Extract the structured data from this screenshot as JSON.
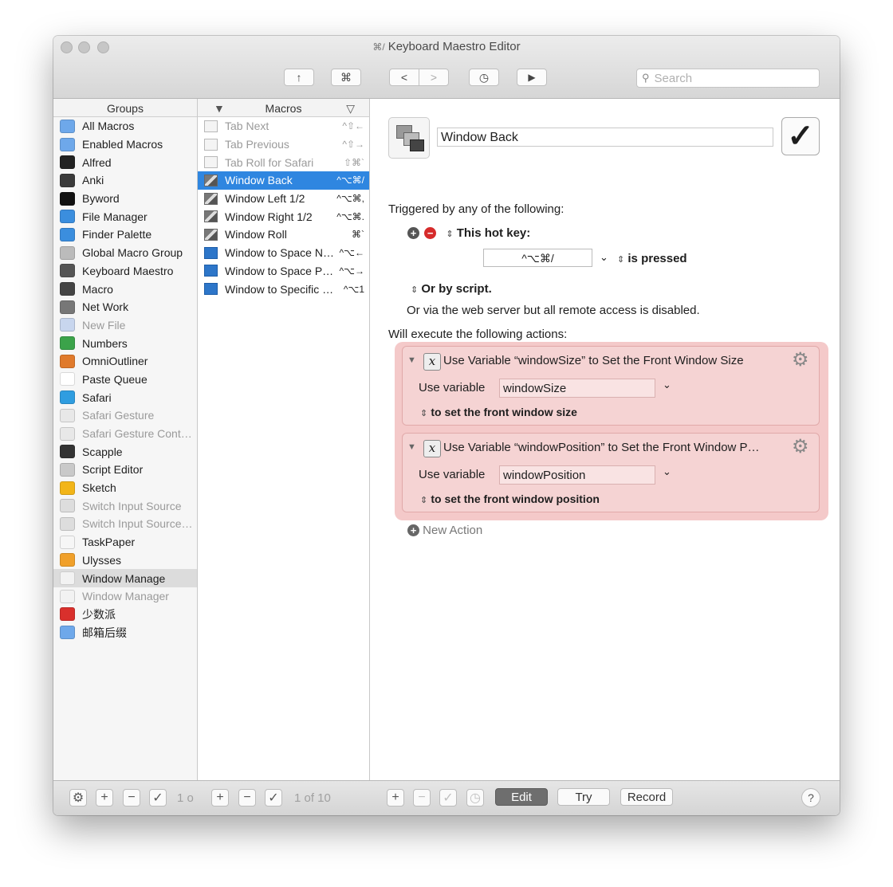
{
  "window": {
    "title": "Keyboard Maestro Editor",
    "title_glyph": "⌘/"
  },
  "toolbar": {
    "share_icon": "↑",
    "cmd_icon": "⌘",
    "back_icon": "<",
    "forward_icon": ">",
    "clock_icon": "◷",
    "run_icon": "▶",
    "search_placeholder": "Search",
    "search_glyph": "⚲"
  },
  "groups": {
    "header": "Groups",
    "items": [
      {
        "label": "All Macros",
        "color": "#6ea8ea",
        "dim": false
      },
      {
        "label": "Enabled Macros",
        "color": "#6ea8ea",
        "dim": false
      },
      {
        "label": "Alfred",
        "color": "#222222",
        "dim": false
      },
      {
        "label": "Anki",
        "color": "#3a3a3a",
        "dim": false
      },
      {
        "label": "Byword",
        "color": "#111111",
        "dim": false
      },
      {
        "label": "File Manager",
        "color": "#3b8ede",
        "dim": false
      },
      {
        "label": "Finder Palette",
        "color": "#3b8ede",
        "dim": false
      },
      {
        "label": "Global Macro Group",
        "color": "#bbbbbb",
        "dim": false
      },
      {
        "label": "Keyboard Maestro",
        "color": "#555555",
        "dim": false
      },
      {
        "label": "Macro",
        "color": "#444444",
        "dim": false
      },
      {
        "label": "Net Work",
        "color": "#777777",
        "dim": false
      },
      {
        "label": "New File",
        "color": "#c8d6ee",
        "dim": true
      },
      {
        "label": "Numbers",
        "color": "#3ba34a",
        "dim": false
      },
      {
        "label": "OmniOutliner",
        "color": "#e07a2c",
        "dim": false
      },
      {
        "label": "Paste Queue",
        "color": "#ffffff",
        "dim": false
      },
      {
        "label": "Safari",
        "color": "#2f9de0",
        "dim": false
      },
      {
        "label": "Safari Gesture",
        "color": "#e8e8e8",
        "dim": true
      },
      {
        "label": "Safari Gesture Contr…",
        "color": "#e8e8e8",
        "dim": true
      },
      {
        "label": "Scapple",
        "color": "#333333",
        "dim": false
      },
      {
        "label": "Script Editor",
        "color": "#c9c9c9",
        "dim": false
      },
      {
        "label": "Sketch",
        "color": "#f2b518",
        "dim": false
      },
      {
        "label": "Switch Input Source",
        "color": "#dddddd",
        "dim": true
      },
      {
        "label": "Switch Input Source…",
        "color": "#dddddd",
        "dim": true
      },
      {
        "label": "TaskPaper",
        "color": "#f6f6f6",
        "dim": false
      },
      {
        "label": "Ulysses",
        "color": "#f0a02a",
        "dim": false
      },
      {
        "label": "Window Manage",
        "color": "#f2f2f2",
        "dim": false,
        "selected": true
      },
      {
        "label": "Window Manager",
        "color": "#f2f2f2",
        "dim": true
      },
      {
        "label": "少数派",
        "color": "#d9302c",
        "dim": false
      },
      {
        "label": "邮箱后缀",
        "color": "#6ea8ea",
        "dim": false
      }
    ]
  },
  "macros": {
    "header": "Macros",
    "sort_icon": "▼",
    "filter_icon": "▽",
    "items": [
      {
        "label": "Tab Next",
        "key": "^⇧←",
        "dim": true,
        "icon": "plain"
      },
      {
        "label": "Tab Previous",
        "key": "^⇧→",
        "dim": true,
        "icon": "plain"
      },
      {
        "label": "Tab Roll for Safari",
        "key": "⇧⌘`",
        "dim": true,
        "icon": "plain"
      },
      {
        "label": "Window Back",
        "key": "^⌥⌘/",
        "dim": false,
        "icon": "stack",
        "selected": true
      },
      {
        "label": "Window Left 1/2",
        "key": "^⌥⌘,",
        "dim": false,
        "icon": "stack"
      },
      {
        "label": "Window Right 1/2",
        "key": "^⌥⌘.",
        "dim": false,
        "icon": "stack"
      },
      {
        "label": "Window Roll",
        "key": "⌘`",
        "dim": false,
        "icon": "stack"
      },
      {
        "label": "Window to Space N…",
        "key": "^⌥←",
        "dim": false,
        "icon": "blue"
      },
      {
        "label": "Window to Space Pr…",
        "key": "^⌥→",
        "dim": false,
        "icon": "blue"
      },
      {
        "label": "Window to Specific S…",
        "key": "^⌥1",
        "dim": false,
        "icon": "blue"
      }
    ]
  },
  "detail": {
    "macro_name": "Window Back",
    "enabled_check": "✓",
    "triggered_text": "Triggered by any of the following:",
    "add_icon": "+",
    "remove_icon": "−",
    "hotkey_label": "This hot key:",
    "hotkey_value": "^⌥⌘/",
    "hotkey_mode": "is pressed",
    "by_script": "Or by script.",
    "web_server": "Or via the web server but all remote access is disabled.",
    "will_execute": "Will execute the following actions:",
    "actions": [
      {
        "title": "Use Variable “windowSize” to Set the Front Window Size",
        "use_variable_label": "Use variable",
        "variable": "windowSize",
        "target": "to set the front window size"
      },
      {
        "title": "Use Variable “windowPosition” to Set the Front Window P…",
        "use_variable_label": "Use variable",
        "variable": "windowPosition",
        "target": "to set the front window position"
      }
    ],
    "new_action": "New Action",
    "x_glyph": "𝑥",
    "gear_icon": "⚙",
    "updown_icon": "⌃⌄",
    "chevron_icon": "⌄"
  },
  "bottom": {
    "gear_icon": "⚙",
    "groups_count": "1 o",
    "macros_count": "1 of 10",
    "edit_label": "Edit",
    "try_label": "Try",
    "record_label": "Record",
    "help_label": "?",
    "plus": "+",
    "minus": "−",
    "check": "✓",
    "clock": "◷"
  },
  "colors": {
    "selection_blue": "#2f86e0",
    "action_bg": "#f5d3d3"
  }
}
